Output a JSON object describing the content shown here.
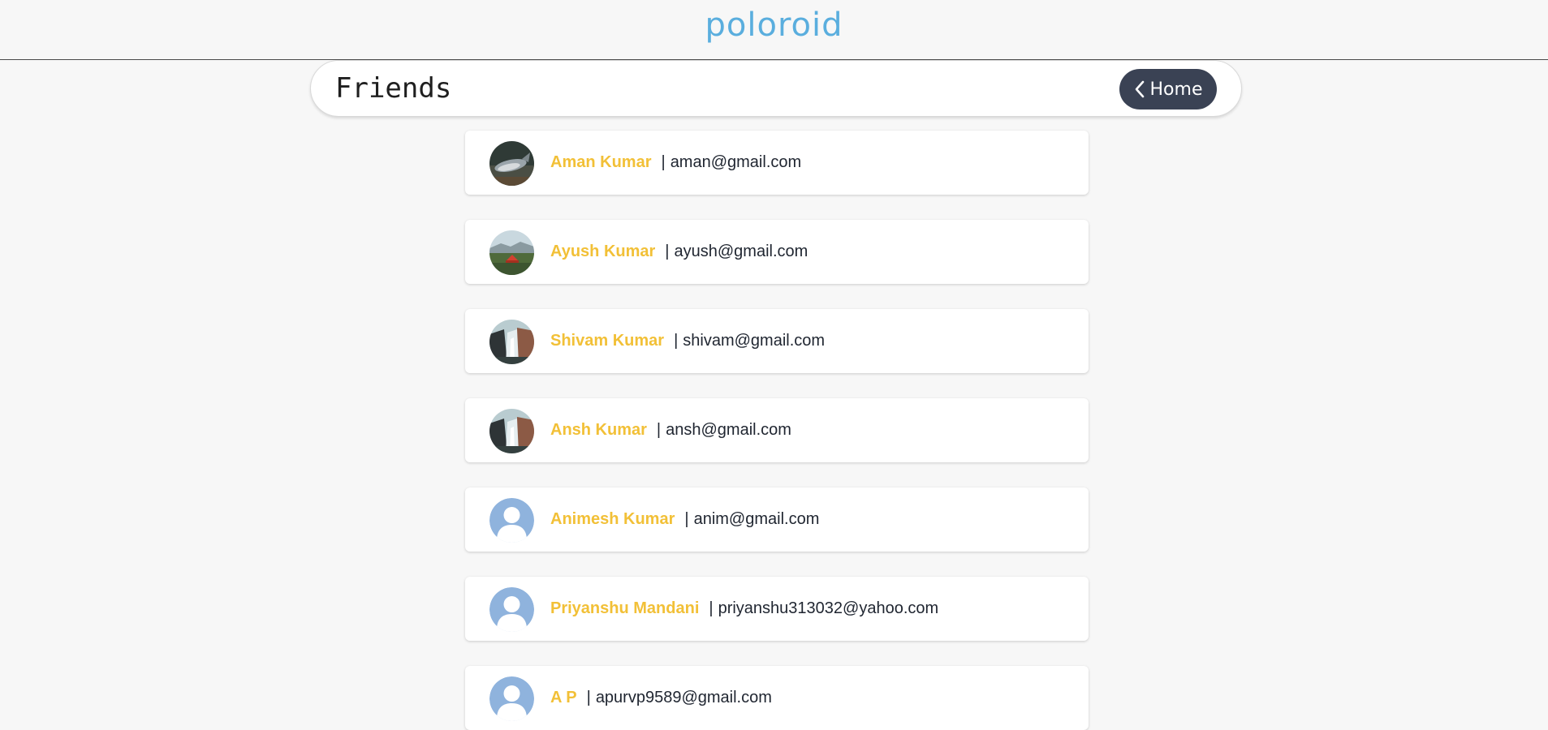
{
  "app": {
    "logo": "poloroid"
  },
  "header": {
    "title": "Friends",
    "home_label": "Home"
  },
  "friends": [
    {
      "name": "Aman Kumar",
      "separator": "|",
      "email": "aman@gmail.com",
      "avatar": "photo-whale"
    },
    {
      "name": "Ayush Kumar",
      "separator": "|",
      "email": "ayush@gmail.com",
      "avatar": "photo-tent-landscape"
    },
    {
      "name": "Shivam Kumar",
      "separator": "|",
      "email": "shivam@gmail.com",
      "avatar": "photo-waterfall"
    },
    {
      "name": "Ansh Kumar",
      "separator": "|",
      "email": "ansh@gmail.com",
      "avatar": "photo-waterfall"
    },
    {
      "name": "Animesh Kumar",
      "separator": "|",
      "email": "anim@gmail.com",
      "avatar": "default-user"
    },
    {
      "name": "Priyanshu Mandani",
      "separator": "|",
      "email": "priyanshu313032@yahoo.com",
      "avatar": "default-user"
    },
    {
      "name": "A P",
      "separator": "|",
      "email": "apurvp9589@gmail.com",
      "avatar": "default-user"
    }
  ],
  "colors": {
    "logo": "#5aaede",
    "name": "#f2c037",
    "home_button": "#3a4254",
    "default_avatar": "#8fb3dd"
  }
}
